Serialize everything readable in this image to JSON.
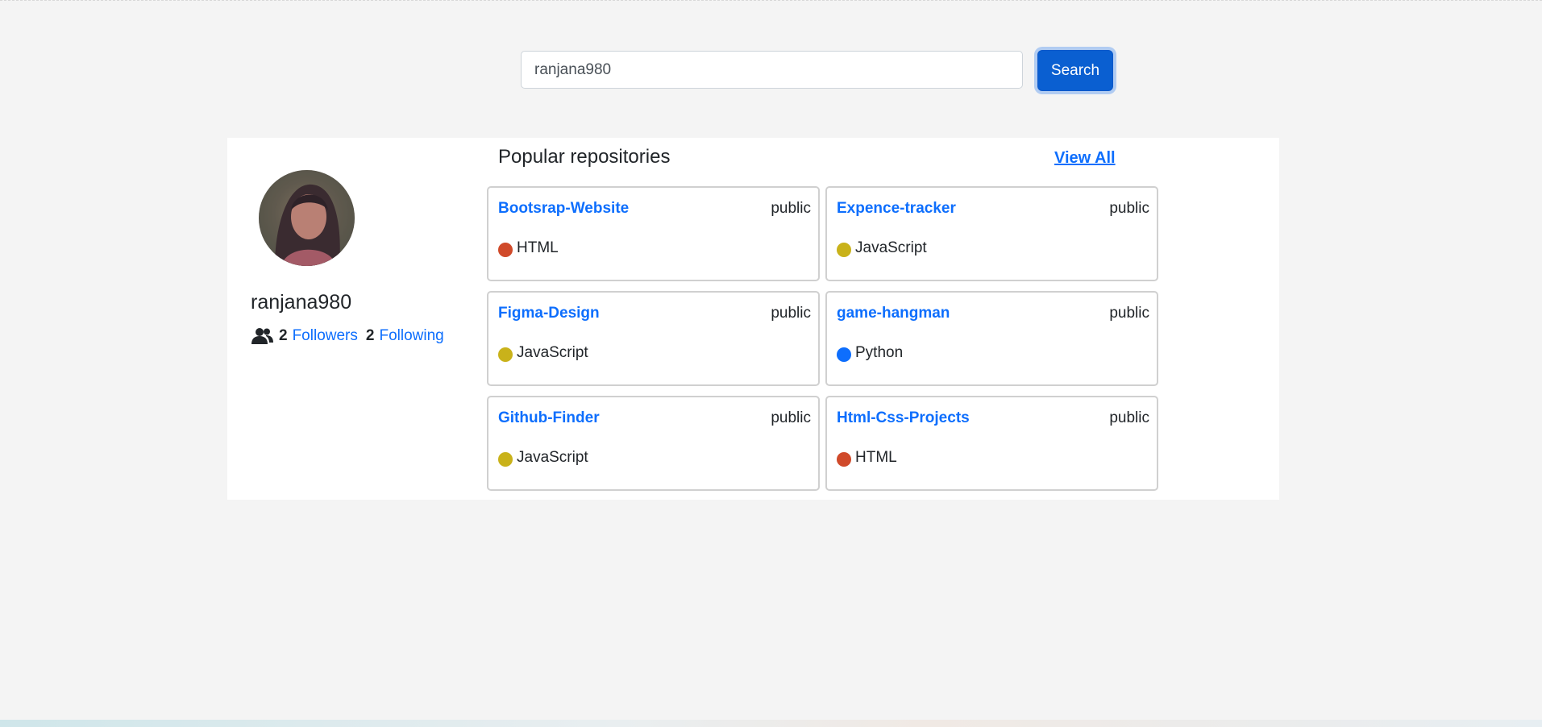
{
  "search": {
    "value": "ranjana980",
    "button_label": "Search"
  },
  "profile": {
    "username": "ranjana980",
    "followers_count": "2",
    "followers_label": "Followers",
    "following_count": "2",
    "following_label": "Following"
  },
  "repos": {
    "title": "Popular repositories",
    "view_all_label": "View All",
    "items": [
      {
        "name": "Bootsrap-Website",
        "visibility": "public",
        "language": "HTML",
        "color": "#d04a2a"
      },
      {
        "name": "Expence-tracker",
        "visibility": "public",
        "language": "JavaScript",
        "color": "#c9b21a"
      },
      {
        "name": "Figma-Design",
        "visibility": "public",
        "language": "JavaScript",
        "color": "#c9b21a"
      },
      {
        "name": "game-hangman",
        "visibility": "public",
        "language": "Python",
        "color": "#0d6efd"
      },
      {
        "name": "Github-Finder",
        "visibility": "public",
        "language": "JavaScript",
        "color": "#c9b21a"
      },
      {
        "name": "Html-Css-Projects",
        "visibility": "public",
        "language": "HTML",
        "color": "#d04a2a"
      }
    ]
  }
}
